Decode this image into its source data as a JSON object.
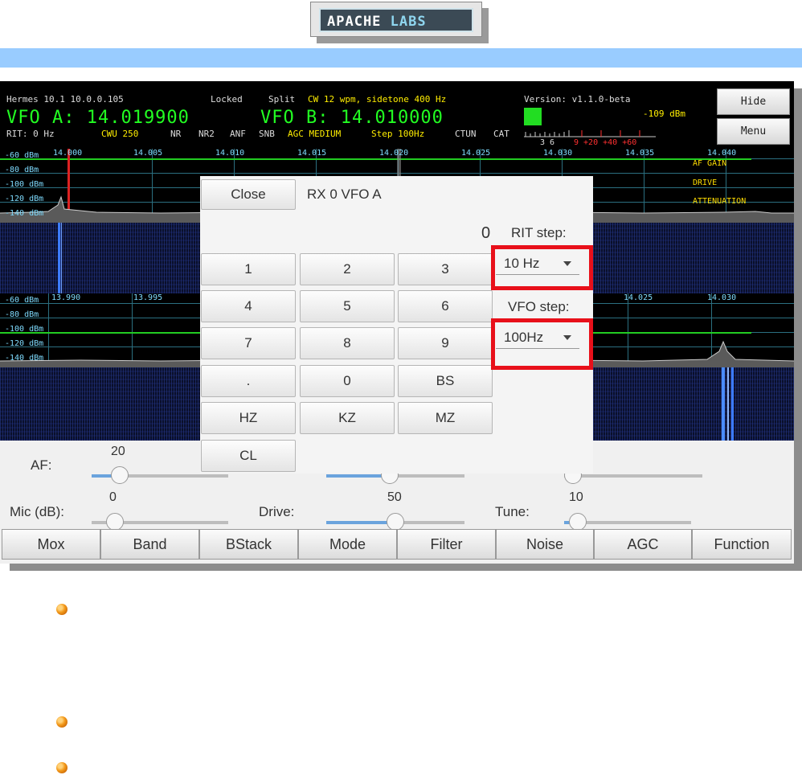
{
  "logo": {
    "word1": "APACHE",
    "word2": "LABS"
  },
  "status": {
    "line1_a": "Hermes 10.1 10.0.0.105",
    "line1_b": "Locked",
    "line1_c": "Split",
    "line1_d": "CW 12 wpm, sidetone 400 Hz",
    "line1_e": "Version: v1.1.0-beta",
    "vfo_a": "VFO A: 14.019900",
    "vfo_b": "VFO B: 14.010000",
    "dbm": "-109 dBm",
    "line3_rit": "RIT: 0 Hz",
    "line3_mode": "CWU 250",
    "line3_nr": "NR",
    "line3_nr2": "NR2",
    "line3_anf": "ANF",
    "line3_snb": "SNB",
    "line3_agc": "AGC MEDIUM",
    "line3_step": "Step 100Hz",
    "line3_ctun": "CTUN",
    "line3_cat": "CAT",
    "meter_scale_a": "3  6",
    "meter_scale_b": "9 +20 +40 +60"
  },
  "side_buttons": {
    "hide": "Hide",
    "menu": "Menu"
  },
  "pan1": {
    "db_labels": [
      "-60 dBm",
      "-80 dBm",
      "-100 dBm",
      "-120 dBm",
      "-140 dBm"
    ],
    "freq_labels": [
      "14.000",
      "14.005",
      "14.010",
      "14.015",
      "14.020",
      "14.025",
      "14.030",
      "14.035",
      "14.040"
    ],
    "right_labels": [
      "AF GAIN",
      "DRIVE",
      "ATTENUATION"
    ]
  },
  "pan2": {
    "db_labels": [
      "-60 dBm",
      "-80 dBm",
      "-100 dBm",
      "-120 dBm",
      "-140 dBm"
    ],
    "freq_labels": [
      "13.990",
      "13.995",
      "14.025",
      "14.030"
    ]
  },
  "dialog": {
    "close": "Close",
    "title": "RX 0 VFO A",
    "value": "0",
    "rit_step_label": "RIT step:",
    "rit_step_value": "10 Hz",
    "vfo_step_label": "VFO step:",
    "vfo_step_value": "100Hz",
    "keys": [
      "1",
      "2",
      "3",
      "4",
      "5",
      "6",
      "7",
      "8",
      "9",
      ".",
      "0",
      "BS",
      "HZ",
      "KZ",
      "MZ",
      "CL"
    ]
  },
  "controls": {
    "af_label": "AF:",
    "af_value": "20",
    "mic_label": "Mic (dB):",
    "mic_value": "0",
    "drive_label": "Drive:",
    "drive_value": "50",
    "tune_label": "Tune:",
    "tune_value": "10"
  },
  "tabs": [
    "Mox",
    "Band",
    "BStack",
    "Mode",
    "Filter",
    "Noise",
    "AGC",
    "Function"
  ]
}
